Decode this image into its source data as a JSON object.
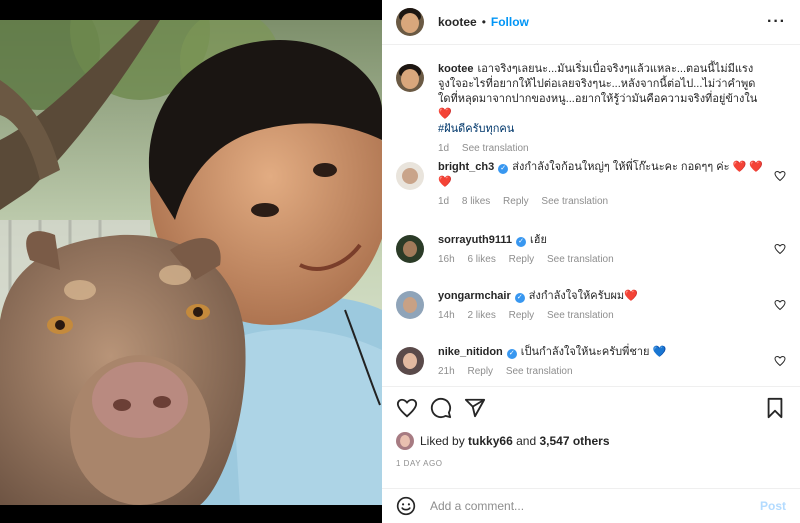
{
  "post": {
    "username": "kootee",
    "separator": "•",
    "follow_label": "Follow",
    "more_label": "···"
  },
  "caption": {
    "username": "kootee",
    "text": "เอาจริงๆเลยนะ...มันเริ่มเบื่อจริงๆแล้วแหละ...ตอนนี้ไม่มีแรงจูงใจอะไรที่อยากให้ไปต่อเลยจริงๆนะ...หลังจากนี้ต่อไป...ไม่ว่าคำพูดใดที่หลุดมาจากปากของหนู...อยากให้รู้ว่ามันคือความจริงที่อยู่ข้างใน",
    "heart": "❤️",
    "hashtag": "#ฝันดีครับทุกคน",
    "time": "1d",
    "see_translation": "See translation"
  },
  "comments": [
    {
      "username": "bright_ch3",
      "verified": true,
      "text": "ส่งกำลังใจก้อนใหญ่ๆ ให้พี่โก๊ะนะคะ กอดๆๆ ค่ะ",
      "emoji": "❤️ ❤️ ❤️",
      "time": "1d",
      "likes": "8 likes",
      "reply": "Reply",
      "see_translation": "See translation"
    },
    {
      "username": "sorrayuth9111",
      "verified": true,
      "text": "เฮ้ย",
      "emoji": "",
      "time": "16h",
      "likes": "6 likes",
      "reply": "Reply",
      "see_translation": "See translation"
    },
    {
      "username": "yongarmchair",
      "verified": true,
      "text": "ส่งกำลังใจให้ครับผม",
      "emoji": "❤️",
      "time": "14h",
      "likes": "2 likes",
      "reply": "Reply",
      "see_translation": "See translation"
    },
    {
      "username": "nike_nitidon",
      "verified": true,
      "text": "เป็นกำลังใจให้นะครับพี่ชาย",
      "emoji": "💙",
      "time": "21h",
      "likes": "",
      "reply": "Reply",
      "see_translation": "See translation"
    }
  ],
  "liked_by": {
    "prefix": "Liked by",
    "user": "tukky66",
    "and": "and",
    "others": "3,547 others"
  },
  "date": "1 DAY AGO",
  "add_comment": {
    "placeholder": "Add a comment...",
    "post_label": "Post"
  },
  "icons": {
    "like": "heart-icon",
    "comment": "comment-icon",
    "share": "share-icon",
    "save": "bookmark-icon",
    "emoji": "emoji-icon"
  },
  "colors": {
    "accent": "#0095f6",
    "verified": "#3897f0",
    "heart": "#ed4956",
    "muted": "#8e8e8e"
  }
}
